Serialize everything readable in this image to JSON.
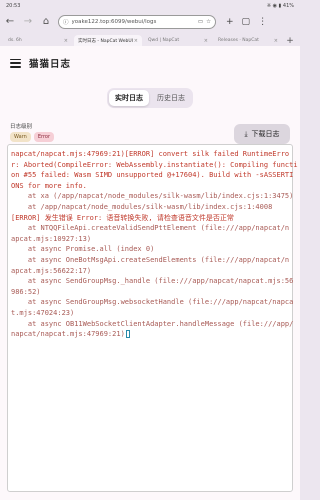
{
  "status_bar": {
    "time": "20:53",
    "icons": "※ ◉ ▮ 41%"
  },
  "browser": {
    "url": "yoake122.top:6099/webui/logs",
    "tabs": [
      {
        "label": "ds. 6h",
        "active": false
      },
      {
        "label": "实时日志 - NapCat WebUI",
        "active": true
      },
      {
        "label": "Qwd | NapCat",
        "active": false
      },
      {
        "label": "Releases · NapCat",
        "active": false
      }
    ]
  },
  "app": {
    "title": "猫猫日志"
  },
  "segment": {
    "realtime": "实时日志",
    "history": "历史日志"
  },
  "filter": {
    "label": "日志级别",
    "chips": [
      "Warn",
      "Error"
    ]
  },
  "download": {
    "label": "下载日志"
  },
  "log_lines": [
    {
      "text": "napcat/napcat.mjs:47969:21)[ERROR] convert silk failed RuntimeErro",
      "kind": "err"
    },
    {
      "text": "r: Aborted(CompileError: WebAssembly.instantiate(): Compiling functi",
      "kind": "err"
    },
    {
      "text": "on #55 failed: Wasm SIMD unsupported @+17604). Build with -sASSERTI",
      "kind": "err"
    },
    {
      "text": "ONS for more info.",
      "kind": "err"
    },
    {
      "text": "    at xa (/app/napcat/node_modules/silk-wasm/lib/index.cjs:1:3475)",
      "kind": "trace"
    },
    {
      "text": "    at /app/napcat/node_modules/silk-wasm/lib/index.cjs:1:4008",
      "kind": "trace"
    },
    {
      "text": "[ERROR] 发生错误 Error: 语音转换失败, 请检查语音文件是否正常",
      "kind": "err"
    },
    {
      "text": "    at NTQQFileApi.createValidSendPttElement (file:///app/napcat/n",
      "kind": "trace"
    },
    {
      "text": "apcat.mjs:10927:13)",
      "kind": "trace"
    },
    {
      "text": "    at async Promise.all (index 0)",
      "kind": "trace"
    },
    {
      "text": "    at async OneBotMsgApi.createSendElements (file:///app/napcat/n",
      "kind": "trace"
    },
    {
      "text": "apcat.mjs:56622:17)",
      "kind": "trace"
    },
    {
      "text": "    at async SendGroupMsg._handle (file:///app/napcat/napcat.mjs:56",
      "kind": "trace"
    },
    {
      "text": "986:52)",
      "kind": "trace"
    },
    {
      "text": "    at async SendGroupMsg.websocketHandle (file:///app/napcat/napca",
      "kind": "trace"
    },
    {
      "text": "t.mjs:47024:23)",
      "kind": "trace"
    },
    {
      "text": "    at async OB11WebSocketClientAdapter.handleMessage (file:///app/",
      "kind": "trace"
    },
    {
      "text": "napcat/napcat.mjs:47969:21)",
      "kind": "trace"
    }
  ]
}
